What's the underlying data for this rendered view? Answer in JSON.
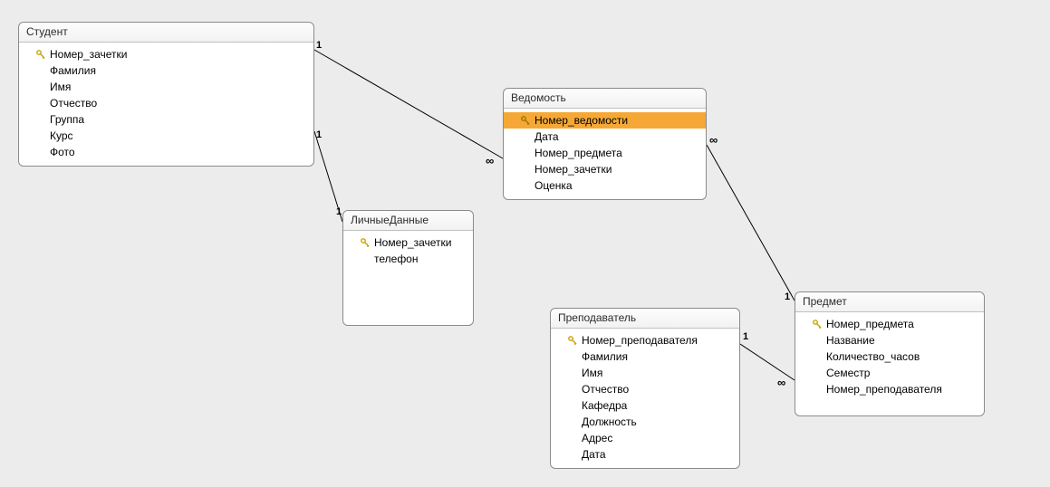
{
  "entities": {
    "student": {
      "title": "Студент",
      "fields": [
        {
          "name": "Номер_зачетки",
          "key": true
        },
        {
          "name": "Фамилия",
          "key": false
        },
        {
          "name": "Имя",
          "key": false
        },
        {
          "name": "Отчество",
          "key": false
        },
        {
          "name": "Группа",
          "key": false
        },
        {
          "name": "Курс",
          "key": false
        },
        {
          "name": "Фото",
          "key": false
        }
      ]
    },
    "personal": {
      "title": "ЛичныеДанные",
      "fields": [
        {
          "name": "Номер_зачетки",
          "key": true
        },
        {
          "name": "телефон",
          "key": false
        }
      ]
    },
    "vedomost": {
      "title": "Ведомость",
      "fields": [
        {
          "name": "Номер_ведомости",
          "key": true,
          "selected": true
        },
        {
          "name": "Дата",
          "key": false
        },
        {
          "name": "Номер_предмета",
          "key": false
        },
        {
          "name": "Номер_зачетки",
          "key": false
        },
        {
          "name": "Оценка",
          "key": false
        }
      ]
    },
    "teacher": {
      "title": "Преподаватель",
      "fields": [
        {
          "name": "Номер_преподавателя",
          "key": true
        },
        {
          "name": "Фамилия",
          "key": false
        },
        {
          "name": "Имя",
          "key": false
        },
        {
          "name": "Отчество",
          "key": false
        },
        {
          "name": "Кафедра",
          "key": false
        },
        {
          "name": "Должность",
          "key": false
        },
        {
          "name": "Адрес",
          "key": false
        },
        {
          "name": "Дата",
          "key": false
        }
      ]
    },
    "subject": {
      "title": "Предмет",
      "fields": [
        {
          "name": "Номер_предмета",
          "key": true
        },
        {
          "name": "Название",
          "key": false
        },
        {
          "name": "Количество_часов",
          "key": false
        },
        {
          "name": "Семестр",
          "key": false
        },
        {
          "name": "Номер_преподавателя",
          "key": false
        }
      ]
    }
  },
  "labels": {
    "one": "1",
    "many": "∞"
  }
}
